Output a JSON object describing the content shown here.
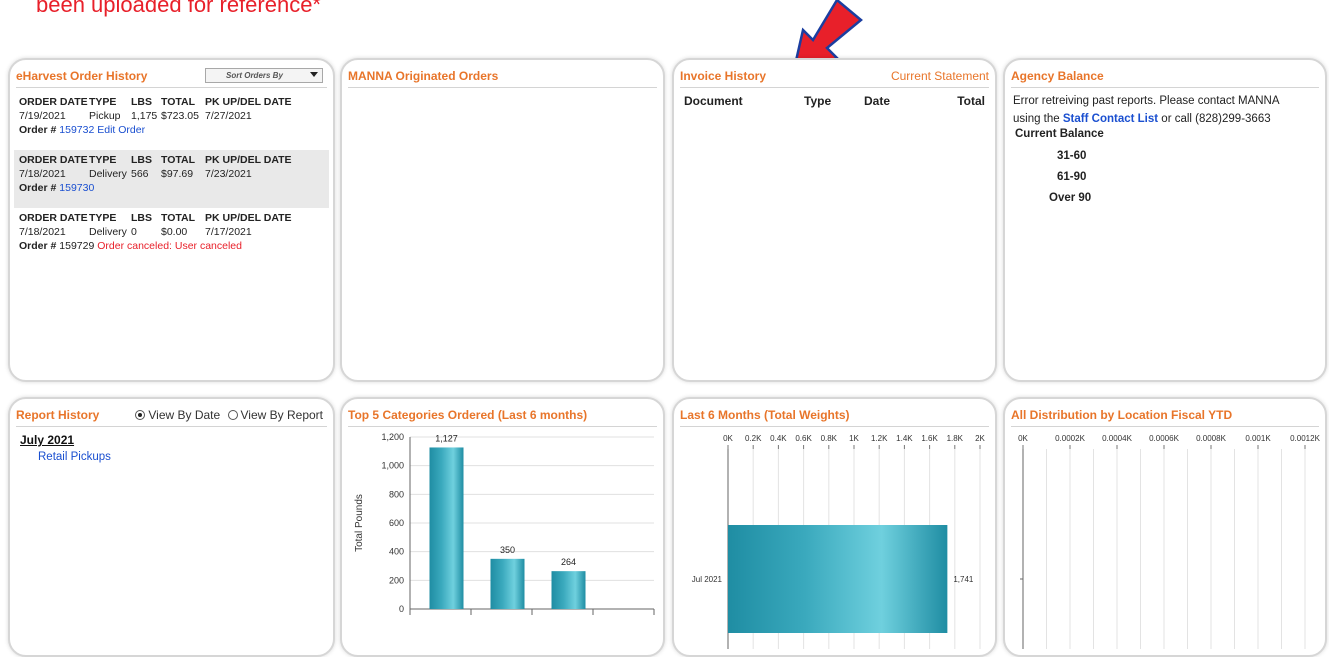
{
  "banner_text": "been uploaded for reference*",
  "accent_color": "#e8752a",
  "order_history": {
    "title": "eHarvest Order History",
    "sort_placeholder": "Sort Orders By",
    "headers": [
      "ORDER DATE",
      "TYPE",
      "LBS",
      "TOTAL",
      "PK UP/DEL DATE"
    ],
    "order_label": "Order #",
    "orders": [
      {
        "date": "7/19/2021",
        "type": "Pickup",
        "lbs": "1,175",
        "total": "$723.05",
        "pk_date": "7/27/2021",
        "number": "159732",
        "action": "Edit Order",
        "status": ""
      },
      {
        "date": "7/18/2021",
        "type": "Delivery",
        "lbs": "566",
        "total": "$97.69",
        "pk_date": "7/23/2021",
        "number": "159730",
        "action": "",
        "status": ""
      },
      {
        "date": "7/18/2021",
        "type": "Delivery",
        "lbs": "0",
        "total": "$0.00",
        "pk_date": "7/17/2021",
        "number": "159729",
        "action": "",
        "status": "Order canceled: User canceled"
      }
    ]
  },
  "manna": {
    "title": "MANNA Originated Orders"
  },
  "invoice": {
    "title": "Invoice History",
    "statement_link": "Current Statement",
    "columns": [
      "Document",
      "Type",
      "Date",
      "Total"
    ]
  },
  "agency": {
    "title": "Agency Balance",
    "error_text_1": "Error retreiving past reports. Please contact MANNA",
    "error_text_2": "using the",
    "staff_link": "Staff Contact List",
    "error_text_3": "or call (828)299-3663",
    "current_balance": "Current Balance",
    "buckets": [
      "31-60",
      "61-90",
      "Over 90"
    ]
  },
  "report_history": {
    "title": "Report History",
    "radio_date": "View By Date",
    "radio_report": "View By Report",
    "selected": "View By Date",
    "month": "July 2021",
    "items": [
      "Retail Pickups"
    ]
  },
  "chart_data": [
    {
      "type": "bar",
      "title": "Top 5 Categories Ordered (Last 6 months)",
      "ylabel": "Total Pounds",
      "ylim": [
        0,
        1200
      ],
      "yticks": [
        "0",
        "200",
        "400",
        "600",
        "800",
        "1,000",
        "1,200"
      ],
      "values": [
        1127,
        350,
        264
      ],
      "value_labels": [
        "1,127",
        "350",
        "264"
      ],
      "bar_color": "#3aa9bd"
    },
    {
      "type": "bar",
      "orientation": "horizontal",
      "title": "Last 6 Months (Total Weights)",
      "categories": [
        "Jul 2021"
      ],
      "values": [
        1741
      ],
      "value_labels": [
        "1,741"
      ],
      "xlim": [
        0,
        2000
      ],
      "xticks": [
        "0K",
        "0.2K",
        "0.4K",
        "0.6K",
        "0.8K",
        "1K",
        "1.2K",
        "1.4K",
        "1.6K",
        "1.8K",
        "2K"
      ],
      "bar_color": "#3aa9bd"
    },
    {
      "type": "bar",
      "orientation": "horizontal",
      "title": "All Distribution by Location Fiscal YTD",
      "categories": [],
      "values": [],
      "xticks": [
        "0K",
        "0.0002K",
        "0.0004K",
        "0.0006K",
        "0.0008K",
        "0.001K",
        "0.0012K"
      ]
    }
  ]
}
